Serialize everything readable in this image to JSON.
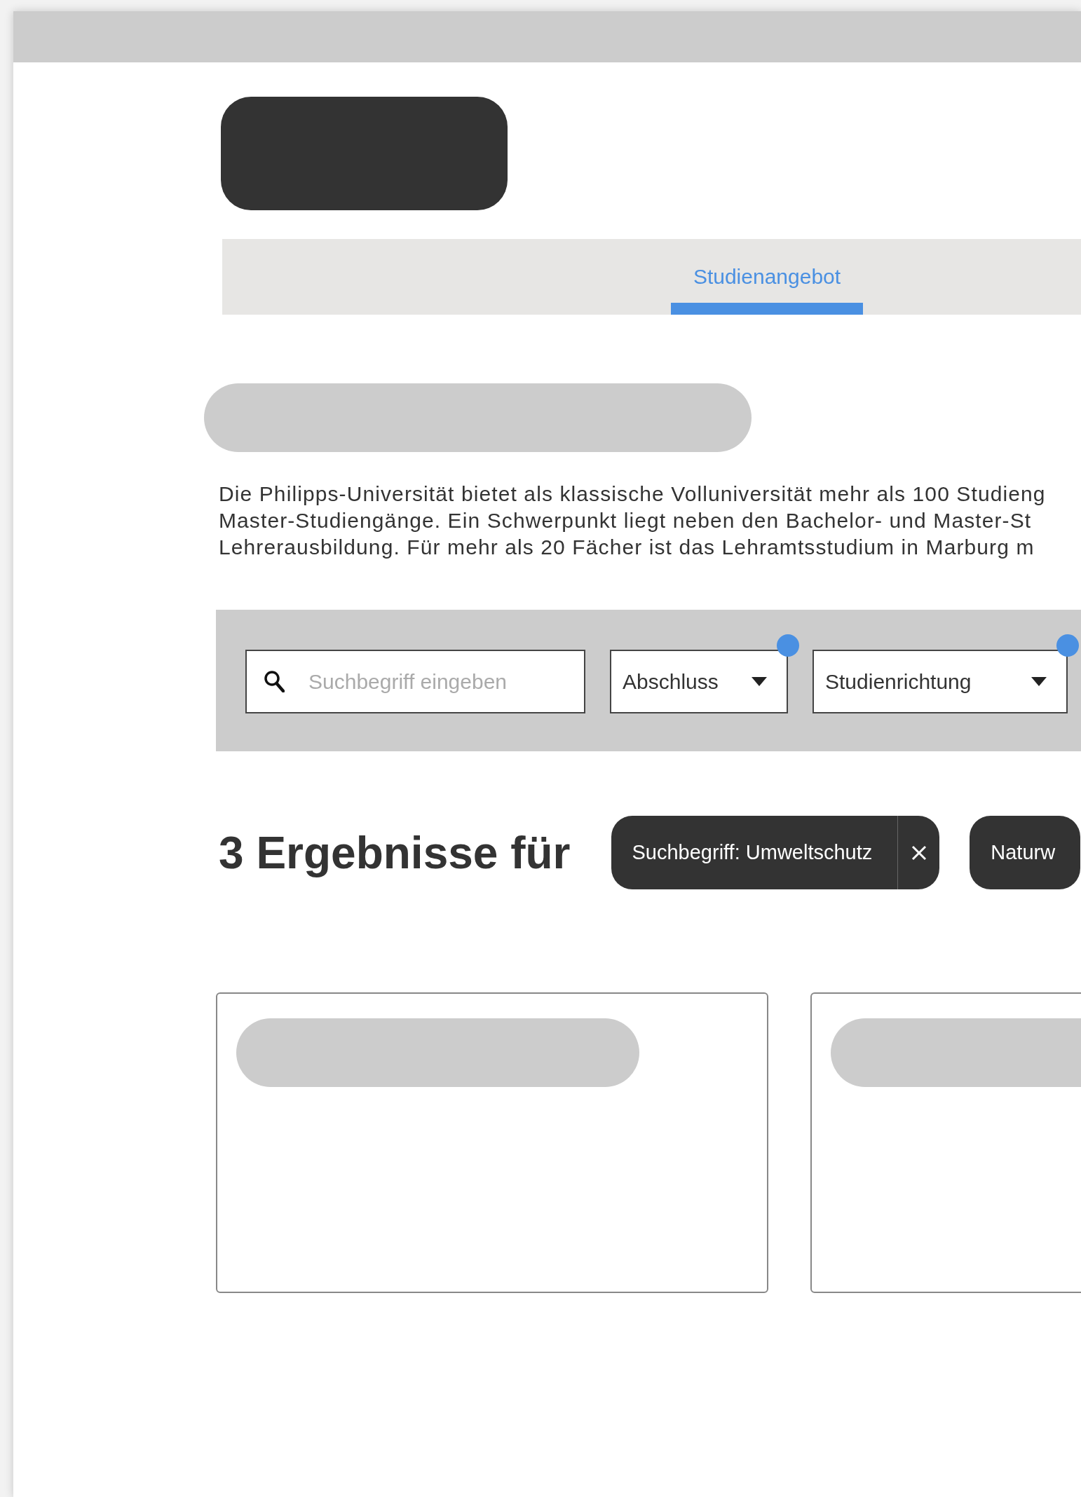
{
  "nav": {
    "tabs": [
      {
        "label": "Studienangebot",
        "selected": true
      }
    ]
  },
  "intro": {
    "lines": [
      "Die Philipps-Universität bietet als klassische Volluniversität mehr als 100 Studieng",
      "Master-Studiengänge. Ein Schwerpunkt liegt neben den Bachelor- und Master-St",
      "Lehrerausbildung. Für mehr als 20 Fächer ist das Lehramtsstudium in Marburg m"
    ]
  },
  "filters": {
    "search": {
      "placeholder": "Suchbegriff eingeben"
    },
    "dropdowns": [
      {
        "label": "Abschluss",
        "active": true
      },
      {
        "label": "Studienrichtung",
        "active": true
      }
    ]
  },
  "results": {
    "heading": "3 Ergebnisse für",
    "chips": [
      {
        "label": "Suchbegriff: Umweltschutz",
        "removable": true
      },
      {
        "label": "Naturw"
      }
    ]
  },
  "cards": [
    {
      "kind": "placeholder"
    },
    {
      "kind": "placeholder"
    }
  ]
}
